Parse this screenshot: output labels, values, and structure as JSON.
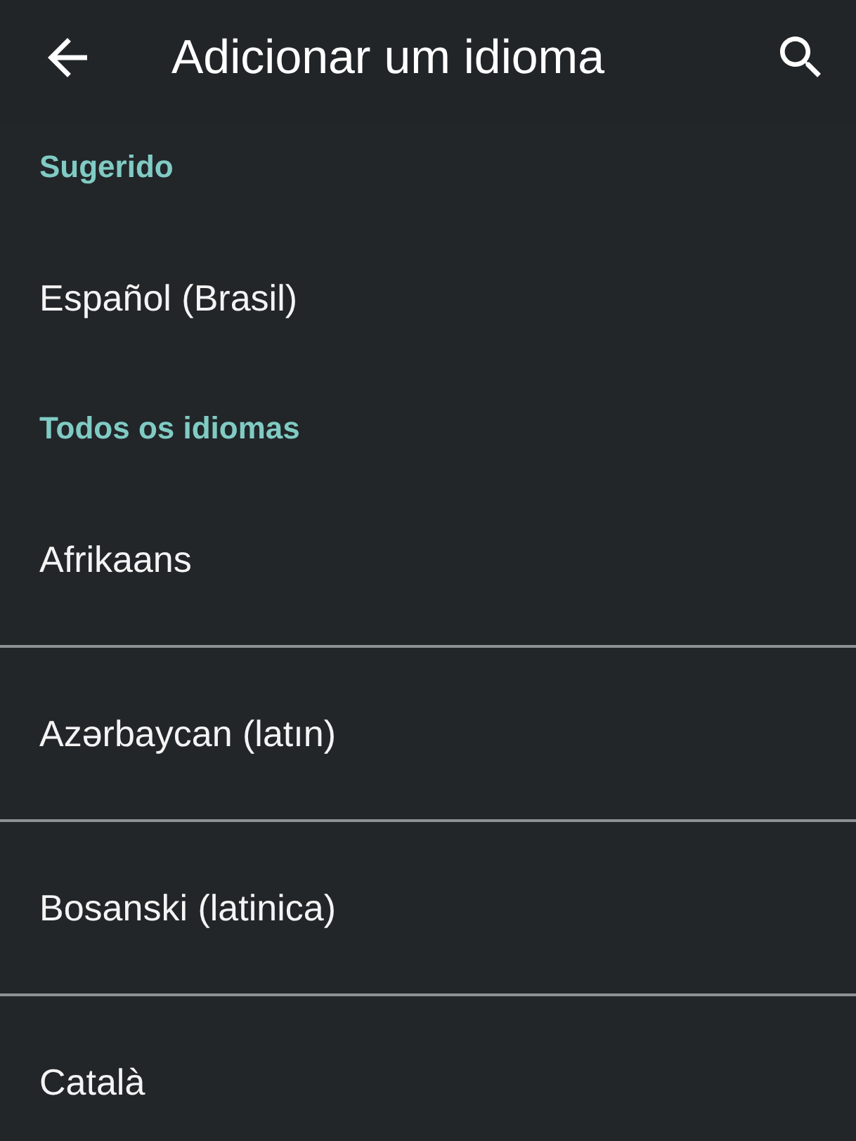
{
  "app_bar": {
    "title": "Adicionar um idioma"
  },
  "sections": [
    {
      "header": "Sugerido",
      "languages": [
        "Español (Brasil)"
      ]
    },
    {
      "header": "Todos os idiomas",
      "languages": [
        "Afrikaans",
        "Azərbaycan (latın)",
        "Bosanski (latinica)",
        "Català"
      ]
    }
  ]
}
